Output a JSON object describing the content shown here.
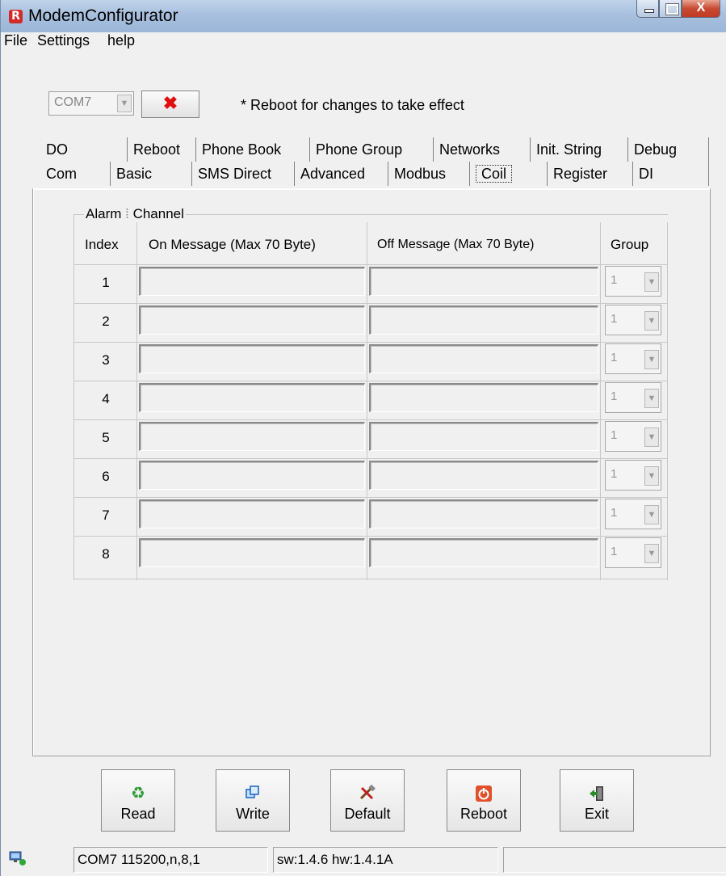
{
  "window": {
    "title": "ModemConfigurator",
    "app_icon": "R",
    "close_glyph": "X"
  },
  "menu": {
    "items": [
      "File",
      "Settings",
      "help"
    ]
  },
  "toolbar": {
    "port": "COM7",
    "disconnect_glyph": "✖",
    "reboot_note": "* Reboot for changes to take effect"
  },
  "tabs": {
    "row1": [
      "DO",
      "Reboot",
      "Phone Book",
      "Phone Group",
      "Networks",
      "Init. String",
      "Debug"
    ],
    "row2": [
      "Com",
      "Basic",
      "SMS Direct",
      "Advanced",
      "Modbus",
      "Coil",
      "Register",
      "DI"
    ],
    "active": "Coil"
  },
  "grid": {
    "legend_left": "Alarm",
    "legend_right": "Channel",
    "headers": {
      "index": "Index",
      "on": "On Message (Max 70 Byte)",
      "off": "Off Message (Max 70 Byte)",
      "group": "Group"
    },
    "rows": [
      {
        "index": "1",
        "on": "",
        "off": "",
        "group": "1"
      },
      {
        "index": "2",
        "on": "",
        "off": "",
        "group": "1"
      },
      {
        "index": "3",
        "on": "",
        "off": "",
        "group": "1"
      },
      {
        "index": "4",
        "on": "",
        "off": "",
        "group": "1"
      },
      {
        "index": "5",
        "on": "",
        "off": "",
        "group": "1"
      },
      {
        "index": "6",
        "on": "",
        "off": "",
        "group": "1"
      },
      {
        "index": "7",
        "on": "",
        "off": "",
        "group": "1"
      },
      {
        "index": "8",
        "on": "",
        "off": "",
        "group": "1"
      }
    ]
  },
  "buttons": {
    "read": {
      "label": "Read",
      "icon": "recycle-icon"
    },
    "write": {
      "label": "Write",
      "icon": "copy-icon"
    },
    "default": {
      "label": "Default",
      "icon": "tools-icon"
    },
    "reboot": {
      "label": "Reboot",
      "icon": "power-icon"
    },
    "exit": {
      "label": "Exit",
      "icon": "exit-door-icon"
    }
  },
  "status": {
    "port": "COM7 115200,n,8,1",
    "version": "sw:1.4.6 hw:1.4.1A",
    "extra": ""
  },
  "colors": {
    "titlebar": "#a8c0de",
    "close": "#c84a32",
    "disconnect": "#e01010",
    "reboot_icon": "#e0502a"
  }
}
